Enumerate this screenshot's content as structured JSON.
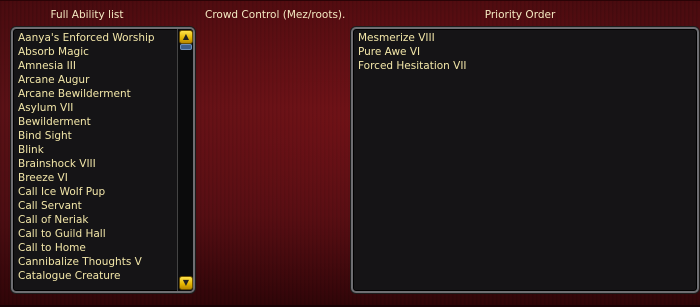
{
  "headers": {
    "full_ability": "Full Ability list",
    "crowd_control": "Crowd Control (Mez/roots).",
    "priority": "Priority Order"
  },
  "ability_list": [
    "Aanya's Enforced Worship",
    "Absorb Magic",
    "Amnesia III",
    "Arcane Augur",
    "Arcane Bewilderment",
    "Asylum VII",
    "Bewilderment",
    "Bind Sight",
    "Blink",
    "Brainshock VIII",
    "Breeze VI",
    "Call Ice Wolf Pup",
    "Call Servant",
    "Call of Neriak",
    "Call to Guild Hall",
    "Call to Home",
    "Cannibalize Thoughts V",
    "Catalogue Creature"
  ],
  "priority_list": [
    "Mesmerize VIII",
    "Pure Awe VI",
    "Forced Hesitation VII"
  ],
  "scrollbar": {
    "up_icon": "▲",
    "down_icon": "▼",
    "position_fraction": 0.0
  },
  "colors": {
    "text": "#f2e6a8",
    "header_text": "#f4e9c2",
    "panel_bg": "#151416",
    "panel_border": "#6e6e72",
    "scroll_button": "#f2c900",
    "background": "#4d0d12"
  }
}
